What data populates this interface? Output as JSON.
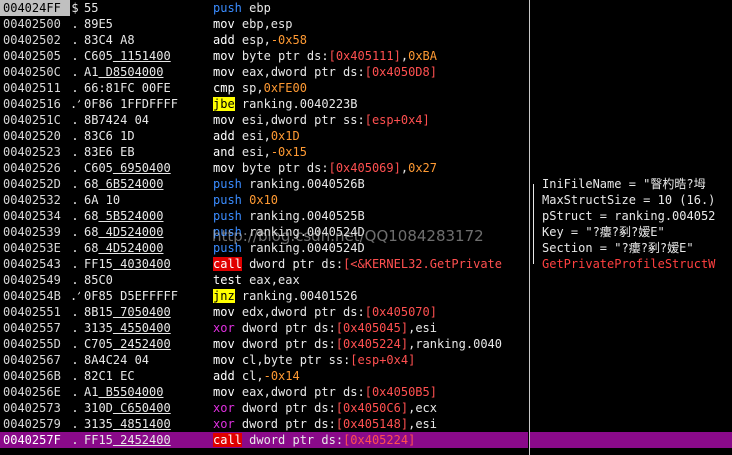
{
  "rows": [
    {
      "addr": "004024FF",
      "mark": "$",
      "hex": "55",
      "dis": [
        [
          "m-push",
          "push "
        ],
        [
          "reg",
          "ebp"
        ]
      ],
      "sel": false
    },
    {
      "addr": "00402500",
      "mark": ".",
      "hex": "89E5",
      "dis": [
        [
          "m-mov",
          "mov "
        ],
        [
          "reg",
          "ebp,esp"
        ]
      ],
      "sel": false
    },
    {
      "addr": "00402502",
      "mark": ".",
      "hex": "83C4 A8",
      "dis": [
        [
          "m-add",
          "add "
        ],
        [
          "reg",
          "esp,"
        ],
        [
          "num",
          "-0x58"
        ]
      ],
      "sel": false
    },
    {
      "addr": "00402505",
      "mark": ".",
      "hex": "C605 1151400",
      "u": true,
      "dis": [
        [
          "m-mov",
          "mov "
        ],
        [
          "op",
          "byte ptr ds:"
        ],
        [
          "mem",
          "[0x405111]"
        ],
        [
          "punc",
          ","
        ],
        [
          "num",
          "0xBA"
        ]
      ],
      "sel": false
    },
    {
      "addr": "0040250C",
      "mark": ".",
      "hex": "A1 D8504000",
      "u": true,
      "dis": [
        [
          "m-mov",
          "mov "
        ],
        [
          "reg",
          "eax,"
        ],
        [
          "op",
          "dword ptr ds:"
        ],
        [
          "mem",
          "[0x4050D8]"
        ]
      ],
      "sel": false
    },
    {
      "addr": "00402511",
      "mark": ".",
      "hex": "66:81FC 00FE",
      "dis": [
        [
          "m-cmp",
          "cmp "
        ],
        [
          "reg",
          "sp,"
        ],
        [
          "num",
          "0xFE00"
        ]
      ],
      "sel": false
    },
    {
      "addr": "00402516",
      "mark": ".^",
      "hex": "0F86 1FFDFFFF",
      "dis": [
        [
          "m-jmp",
          "jbe"
        ],
        [
          "op",
          " ranking.0040223B"
        ]
      ],
      "sel": false
    },
    {
      "addr": "0040251C",
      "mark": ".",
      "hex": "8B7424 04",
      "dis": [
        [
          "m-mov",
          "mov "
        ],
        [
          "reg",
          "esi,"
        ],
        [
          "op",
          "dword ptr ss:"
        ],
        [
          "mem",
          "[esp+0x4]"
        ]
      ],
      "sel": false
    },
    {
      "addr": "00402520",
      "mark": ".",
      "hex": "83C6 1D",
      "dis": [
        [
          "m-add",
          "add "
        ],
        [
          "reg",
          "esi,"
        ],
        [
          "num",
          "0x1D"
        ]
      ],
      "sel": false
    },
    {
      "addr": "00402523",
      "mark": ".",
      "hex": "83E6 EB",
      "dis": [
        [
          "m-add",
          "and "
        ],
        [
          "reg",
          "esi,"
        ],
        [
          "num",
          "-0x15"
        ]
      ],
      "sel": false
    },
    {
      "addr": "00402526",
      "mark": ".",
      "hex": "C605 6950400",
      "u": true,
      "dis": [
        [
          "m-mov",
          "mov "
        ],
        [
          "op",
          "byte ptr ds:"
        ],
        [
          "mem",
          "[0x405069]"
        ],
        [
          "punc",
          ","
        ],
        [
          "num",
          "0x27"
        ]
      ],
      "sel": false
    },
    {
      "addr": "0040252D",
      "mark": ".",
      "hex": "68 6B524000",
      "u": true,
      "dis": [
        [
          "m-push",
          "push "
        ],
        [
          "op",
          "ranking.0040526B"
        ]
      ],
      "sel": false
    },
    {
      "addr": "00402532",
      "mark": ".",
      "hex": "6A 10",
      "dis": [
        [
          "m-push",
          "push "
        ],
        [
          "num",
          "0x10"
        ]
      ],
      "sel": false
    },
    {
      "addr": "00402534",
      "mark": ".",
      "hex": "68 5B524000",
      "u": true,
      "dis": [
        [
          "m-push",
          "push "
        ],
        [
          "op",
          "ranking.0040525B"
        ]
      ],
      "sel": false
    },
    {
      "addr": "00402539",
      "mark": ".",
      "hex": "68 4D524000",
      "u": true,
      "dis": [
        [
          "m-push",
          "push "
        ],
        [
          "op",
          "ranking.0040524D"
        ]
      ],
      "sel": false
    },
    {
      "addr": "0040253E",
      "mark": ".",
      "hex": "68 4D524000",
      "u": true,
      "dis": [
        [
          "m-push",
          "push "
        ],
        [
          "op",
          "ranking.0040524D"
        ]
      ],
      "sel": false
    },
    {
      "addr": "00402543",
      "mark": ".",
      "hex": "FF15 4030400",
      "u": true,
      "dis": [
        [
          "m-call",
          "call"
        ],
        [
          "op",
          " dword ptr ds:"
        ],
        [
          "mem",
          "[<&KERNEL32.GetPrivate"
        ]
      ],
      "sel": false
    },
    {
      "addr": "00402549",
      "mark": ".",
      "hex": "85C0",
      "dis": [
        [
          "m-test",
          "test "
        ],
        [
          "reg",
          "eax,eax"
        ]
      ],
      "sel": false
    },
    {
      "addr": "0040254B",
      "mark": ".^",
      "hex": "0F85 D5EFFFFF",
      "dis": [
        [
          "m-jmp",
          "jnz"
        ],
        [
          "op",
          " ranking.00401526"
        ]
      ],
      "sel": false
    },
    {
      "addr": "00402551",
      "mark": ".",
      "hex": "8B15 7050400",
      "u": true,
      "dis": [
        [
          "m-mov",
          "mov "
        ],
        [
          "reg",
          "edx,"
        ],
        [
          "op",
          "dword ptr ds:"
        ],
        [
          "mem",
          "[0x405070]"
        ]
      ],
      "sel": false
    },
    {
      "addr": "00402557",
      "mark": ".",
      "hex": "3135 4550400",
      "u": true,
      "dis": [
        [
          "m-xor",
          "xor "
        ],
        [
          "op",
          "dword ptr ds:"
        ],
        [
          "mem",
          "[0x405045]"
        ],
        [
          "punc",
          ","
        ],
        [
          "reg",
          "esi"
        ]
      ],
      "sel": false
    },
    {
      "addr": "0040255D",
      "mark": ".",
      "hex": "C705 2452400",
      "u": true,
      "dis": [
        [
          "m-mov",
          "mov "
        ],
        [
          "op",
          "dword ptr ds:"
        ],
        [
          "mem",
          "[0x405224]"
        ],
        [
          "punc",
          ","
        ],
        [
          "op",
          "ranking.0040"
        ]
      ],
      "sel": false
    },
    {
      "addr": "00402567",
      "mark": ".",
      "hex": "8A4C24 04",
      "dis": [
        [
          "m-mov",
          "mov "
        ],
        [
          "reg",
          "cl,"
        ],
        [
          "op",
          "byte ptr ss:"
        ],
        [
          "mem",
          "[esp+0x4]"
        ]
      ],
      "sel": false
    },
    {
      "addr": "0040256B",
      "mark": ".",
      "hex": "82C1 EC",
      "dis": [
        [
          "m-add",
          "add "
        ],
        [
          "reg",
          "cl,"
        ],
        [
          "num",
          "-0x14"
        ]
      ],
      "sel": false
    },
    {
      "addr": "0040256E",
      "mark": ".",
      "hex": "A1 B5504000",
      "u": true,
      "dis": [
        [
          "m-mov",
          "mov "
        ],
        [
          "reg",
          "eax,"
        ],
        [
          "op",
          "dword ptr ds:"
        ],
        [
          "mem",
          "[0x4050B5]"
        ]
      ],
      "sel": false
    },
    {
      "addr": "00402573",
      "mark": ".",
      "hex": "310D C650400",
      "u": true,
      "dis": [
        [
          "m-xor",
          "xor "
        ],
        [
          "op",
          "dword ptr ds:"
        ],
        [
          "mem",
          "[0x4050C6]"
        ],
        [
          "punc",
          ","
        ],
        [
          "reg",
          "ecx"
        ]
      ],
      "sel": false
    },
    {
      "addr": "00402579",
      "mark": ".",
      "hex": "3135 4851400",
      "u": true,
      "dis": [
        [
          "m-xor",
          "xor "
        ],
        [
          "op",
          "dword ptr ds:"
        ],
        [
          "mem",
          "[0x405148]"
        ],
        [
          "punc",
          ","
        ],
        [
          "reg",
          "esi"
        ]
      ],
      "sel": false
    },
    {
      "addr": "0040257F",
      "mark": ".",
      "hex": "FF15 2452400",
      "u": true,
      "dis": [
        [
          "m-call",
          "call"
        ],
        [
          "op",
          " dword ptr ds:"
        ],
        [
          "mem",
          "[0x405224]"
        ]
      ],
      "sel": true
    }
  ],
  "comments": [
    {
      "row": 11,
      "text": "IniFileName = \"瞖杓晧?坶",
      "red": false
    },
    {
      "row": 12,
      "text": "MaxStructSize = 10 (16.)",
      "red": false
    },
    {
      "row": 13,
      "text": "pStruct = ranking.004052",
      "red": false
    },
    {
      "row": 14,
      "text": "Key = \"?瘻?剢?嫒E\"",
      "red": false
    },
    {
      "row": 15,
      "text": "Section = \"?瘻?剢?嫒E\"",
      "red": false
    },
    {
      "row": 16,
      "text": "GetPrivateProfileStructW",
      "red": true
    }
  ],
  "watermark": "http://blog.csdn.net/QQ1084283172",
  "colors": {
    "selection": "#8a0a8a",
    "jump": "#ffff00",
    "call": "#e00000",
    "push": "#3a8cff",
    "xor": "#e030e0",
    "number": "#ff9a33",
    "memory": "#ff5050"
  }
}
